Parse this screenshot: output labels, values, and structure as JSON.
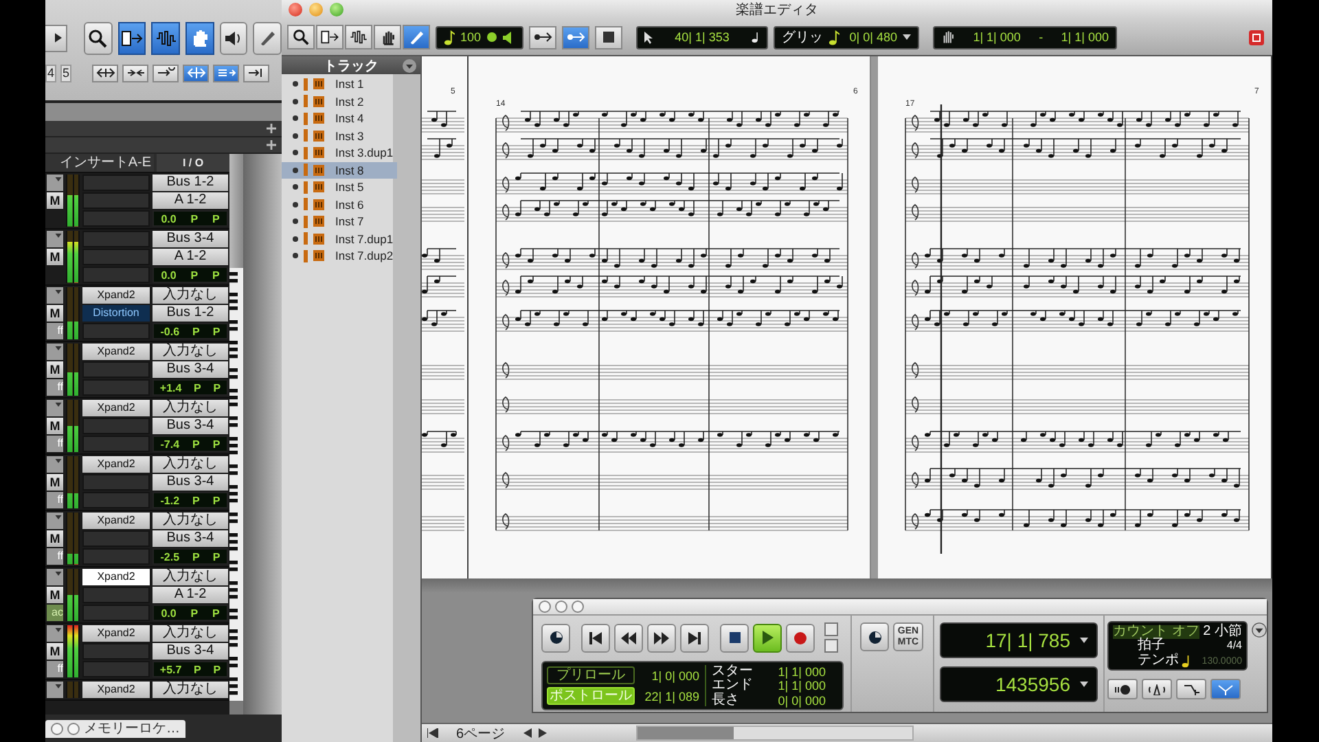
{
  "mixer": {
    "tools": [
      {
        "kind": "zoom",
        "selected": false
      },
      {
        "kind": "trim",
        "selected": true
      },
      {
        "kind": "select",
        "selected": true
      },
      {
        "kind": "grab",
        "selected": true
      },
      {
        "kind": "speaker",
        "selected": false
      },
      {
        "kind": "pencil",
        "selected": false
      }
    ],
    "edit_keys": [
      "4",
      "5"
    ],
    "edit_modes": [
      {
        "kind": "spread",
        "on": false
      },
      {
        "kind": "nudge",
        "on": false
      },
      {
        "kind": "link",
        "on": false
      },
      {
        "kind": "tab",
        "on": true
      },
      {
        "kind": "mirror",
        "on": true
      },
      {
        "kind": "cut",
        "on": false
      }
    ],
    "columns": {
      "inserts": "インサートA-E",
      "io": "I / O"
    },
    "channels": [
      {
        "mute": "M",
        "level": 0.6,
        "output": "Bus 1-2",
        "input": "A 1-2",
        "volume": "0.0",
        "pan": [
          "P",
          "P"
        ]
      },
      {
        "mute": "M",
        "level": 0.78,
        "output": "Bus 3-4",
        "input": "A 1-2",
        "volume": "0.0",
        "pan": [
          "P",
          "P"
        ]
      },
      {
        "mute": "M",
        "tag": "ff",
        "tag_lit": false,
        "level": 0.35,
        "inserts": [
          {
            "name": "Xpand2",
            "selected": false,
            "highlighted": false
          },
          {
            "name": "Distortion",
            "selected": false,
            "highlighted": true
          }
        ],
        "output": "入力なし",
        "input": "Bus 1-2",
        "volume": "-0.6",
        "pan": [
          "P",
          "P"
        ]
      },
      {
        "mute": "M",
        "tag": "ff",
        "tag_lit": false,
        "level": 0.45,
        "inserts": [
          {
            "name": "Xpand2",
            "selected": false,
            "highlighted": false
          }
        ],
        "output": "入力なし",
        "input": "Bus 3-4",
        "volume": "+1.4",
        "pan": [
          "P",
          "P"
        ]
      },
      {
        "mute": "M",
        "tag": "ff",
        "tag_lit": false,
        "level": 0.5,
        "inserts": [
          {
            "name": "Xpand2",
            "selected": false,
            "highlighted": false
          }
        ],
        "output": "入力なし",
        "input": "Bus 3-4",
        "volume": "-7.4",
        "pan": [
          "P",
          "P"
        ]
      },
      {
        "mute": "M",
        "tag": "ff",
        "tag_lit": false,
        "level": 0.3,
        "inserts": [
          {
            "name": "Xpand2",
            "selected": false,
            "highlighted": false
          }
        ],
        "output": "入力なし",
        "input": "Bus 3-4",
        "volume": "-1.2",
        "pan": [
          "P",
          "P"
        ]
      },
      {
        "mute": "M",
        "tag": "ff",
        "tag_lit": false,
        "level": 0.2,
        "inserts": [
          {
            "name": "Xpand2",
            "selected": false,
            "highlighted": false
          }
        ],
        "output": "入力なし",
        "input": "Bus 3-4",
        "volume": "-2.5",
        "pan": [
          "P",
          "P"
        ]
      },
      {
        "mute": "M",
        "tag": "ac",
        "tag_lit": true,
        "level": 0.5,
        "inserts": [
          {
            "name": "Xpand2",
            "selected": true,
            "highlighted": false
          }
        ],
        "output": "入力なし",
        "input": "A 1-2",
        "volume": "0.0",
        "pan": [
          "P",
          "P"
        ]
      },
      {
        "mute": "M",
        "tag": "ff",
        "tag_lit": false,
        "level": 1,
        "inserts": [
          {
            "name": "Xpand2",
            "selected": false,
            "highlighted": false
          }
        ],
        "output": "入力なし",
        "input": "Bus 3-4",
        "volume": "+5.7",
        "pan": [
          "P",
          "P"
        ]
      },
      {
        "inserts": [
          {
            "name": "Xpand2",
            "selected": false,
            "highlighted": false
          }
        ],
        "output": "入力なし"
      }
    ],
    "memory_location": "メモリーロケ…"
  },
  "score_editor": {
    "title": "楽譜エディタ",
    "tools": [
      {
        "kind": "zoom",
        "selected": false
      },
      {
        "kind": "trim",
        "selected": false
      },
      {
        "kind": "select",
        "selected": false
      },
      {
        "kind": "grab",
        "selected": false
      },
      {
        "kind": "pencil",
        "selected": true
      }
    ],
    "velocity": "100",
    "toggles": [
      {
        "kind": "link",
        "on": false
      },
      {
        "kind": "tab",
        "on": true
      },
      {
        "kind": "stop",
        "on": false
      }
    ],
    "cursor_position": "40| 1| 353",
    "grid": {
      "label": "グリッ",
      "value": "0| 0| 480"
    },
    "range": {
      "start": "1| 1| 000",
      "separator": "-",
      "end": "1| 1| 000"
    },
    "track_header": "トラック",
    "tracks": [
      {
        "name": "Inst 1",
        "selected": false
      },
      {
        "name": "Inst 2",
        "selected": false
      },
      {
        "name": "Inst 4",
        "selected": false
      },
      {
        "name": "Inst 3",
        "selected": false
      },
      {
        "name": "Inst 3.dup1",
        "selected": false
      },
      {
        "name": "Inst 8",
        "selected": true
      },
      {
        "name": "Inst 5",
        "selected": false
      },
      {
        "name": "Inst 6",
        "selected": false
      },
      {
        "name": "Inst 7",
        "selected": false
      },
      {
        "name": "Inst 7.dup1",
        "selected": false
      },
      {
        "name": "Inst 7.dup2",
        "selected": false
      }
    ],
    "pages": [
      {
        "number": "5"
      },
      {
        "number": "6",
        "measure": "14"
      },
      {
        "number": "7",
        "measure": "17"
      }
    ],
    "page_indicator": "6ページ"
  },
  "transport": {
    "buttons": [
      {
        "kind": "online",
        "on": false
      },
      {
        "kind": "start",
        "on": false
      },
      {
        "kind": "rewind",
        "on": false
      },
      {
        "kind": "forward",
        "on": false
      },
      {
        "kind": "end",
        "on": false
      },
      {
        "kind": "stop",
        "on": false
      },
      {
        "kind": "play",
        "on": true
      },
      {
        "kind": "record",
        "on": false
      }
    ],
    "rolls": [
      {
        "label": "プリロール",
        "value": "1| 0| 000",
        "on": false
      },
      {
        "label": "ポストロール",
        "value": "22| 1| 089",
        "on": true
      }
    ],
    "selection": [
      {
        "label": "スター",
        "value": "1| 1| 000"
      },
      {
        "label": "エンド",
        "value": "1| 1| 000"
      },
      {
        "label": "長さ",
        "value": "0| 0| 000"
      }
    ],
    "sync": "GEN MTC",
    "main_counter": "17| 1| 785",
    "sub_counter": "1435956",
    "count_off": "カウント オフ",
    "bars": "2 小節",
    "meter_label": "拍子",
    "meter_value": "4/4",
    "tempo_label": "テンポ",
    "tempo_value": "130.0000",
    "mode_buttons": [
      {
        "kind": "wait",
        "on": false
      },
      {
        "kind": "click",
        "on": false
      },
      {
        "kind": "merge",
        "on": false
      },
      {
        "kind": "conductor",
        "on": true
      }
    ]
  }
}
